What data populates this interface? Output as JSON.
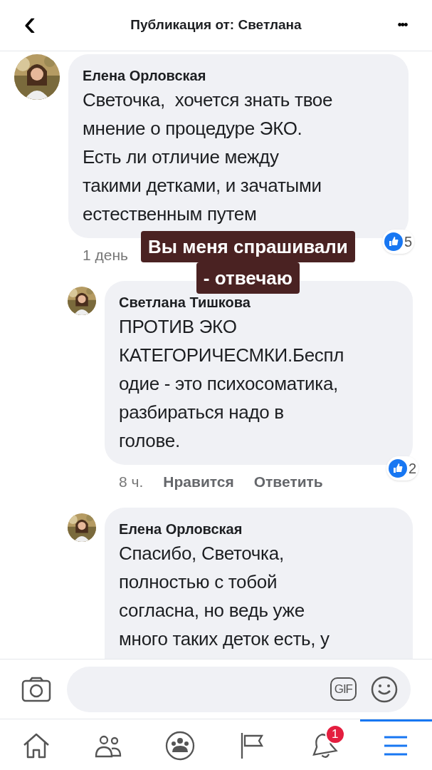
{
  "header": {
    "title": "Публикация от: Светлана",
    "back": "‹",
    "more": "•••"
  },
  "comments": [
    {
      "author": "Елена Орловская",
      "text": "Светочка,  хочется знать твое\nмнение о процедуре ЭКО.\nЕсть ли отличие между\nтакими детками, и зачатыми\nестественным путем",
      "reply": false,
      "time": "1 день",
      "reactions": "5"
    },
    {
      "author": "Светлана Тишкова",
      "text": "ПРОТИВ ЭКО\nКАТЕГОРИЧЕСМКИ.Беспл\nодие - это психосоматика,\nразбираться надо в\nголове.",
      "reply": true,
      "time": "8 ч.",
      "actions": [
        "Нравится",
        "Ответить"
      ],
      "reactions": "2"
    },
    {
      "author": "Елена Орловская",
      "text": "Спасибо, Светочка,\nполностью с тобой\nсогласна, но ведь уже\nмного таких деток есть, у",
      "reply": true,
      "cut": true
    }
  ],
  "sticker": {
    "lines": [
      "Вы меня спрашивали",
      "- отвечаю"
    ]
  },
  "composer": {
    "gif": "GIF"
  },
  "nav": [
    {
      "kind": "home",
      "selected": false
    },
    {
      "kind": "friends",
      "selected": false
    },
    {
      "kind": "groups",
      "selected": false
    },
    {
      "kind": "pages",
      "selected": false
    },
    {
      "kind": "bell",
      "selected": false,
      "badge": "1"
    },
    {
      "kind": "menu",
      "selected": true
    }
  ]
}
